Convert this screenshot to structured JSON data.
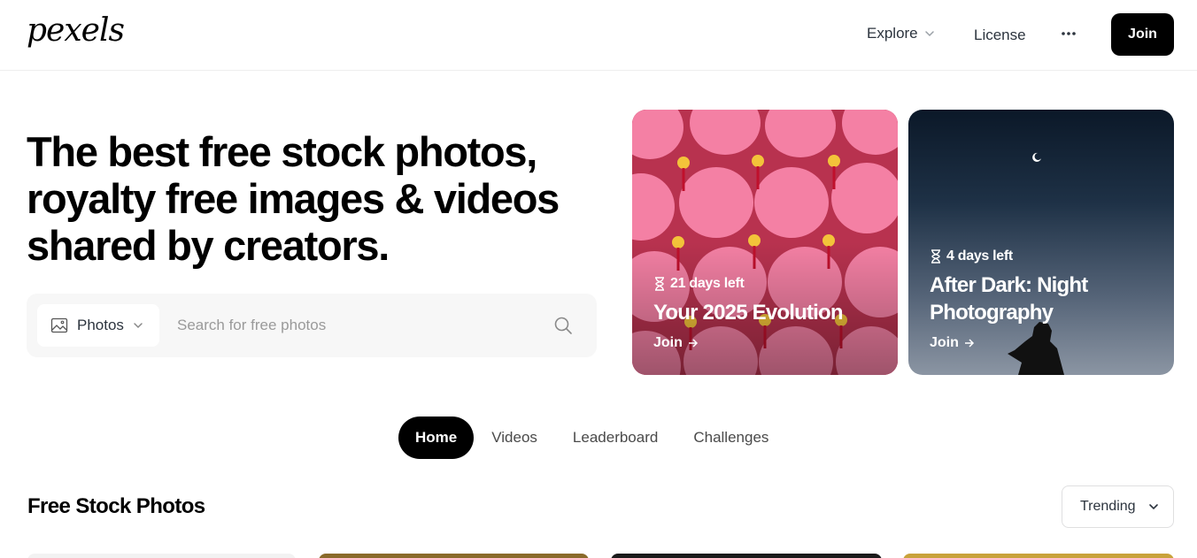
{
  "header": {
    "logo": "pexels",
    "nav": {
      "explore": "Explore",
      "license": "License",
      "more_icon": "more-horizontal-icon"
    },
    "join_label": "Join"
  },
  "hero": {
    "title": "The best free stock photos, royalty free images & videos shared by creators.",
    "search": {
      "type_label": "Photos",
      "type_icon": "image-icon",
      "placeholder": "Search for free photos",
      "search_icon": "search-icon"
    }
  },
  "challenges": [
    {
      "days_left": "21 days left",
      "title": "Your 2025 Evolution",
      "cta": "Join"
    },
    {
      "days_left": "4 days left",
      "title": "After Dark: Night Photography",
      "cta": "Join"
    }
  ],
  "tabs": [
    {
      "label": "Home",
      "active": true
    },
    {
      "label": "Videos",
      "active": false
    },
    {
      "label": "Leaderboard",
      "active": false
    },
    {
      "label": "Challenges",
      "active": false
    }
  ],
  "section": {
    "title": "Free Stock Photos",
    "sort_label": "Trending"
  },
  "colors": {
    "primary": "#000000",
    "card1_bg": "#c23a5a",
    "lantern": "#f27aa0",
    "night_sky": "#1e3146"
  }
}
